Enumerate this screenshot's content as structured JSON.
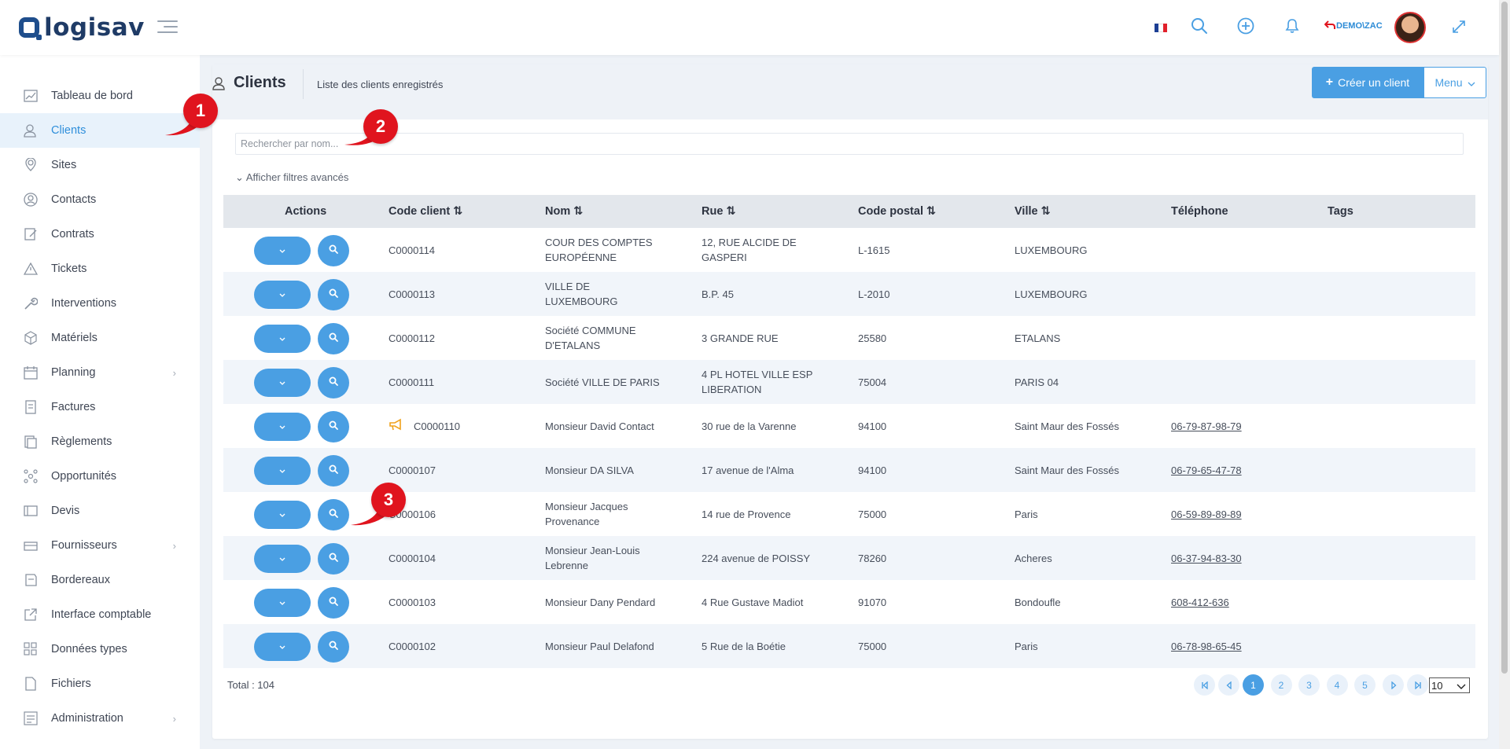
{
  "app": {
    "logo_text": "logisav",
    "user_label": "DEMO\\ZAC"
  },
  "colors": {
    "accent": "#4a9fe3",
    "brand": "#1f3b66",
    "annotation": "#e0141e"
  },
  "sidebar": {
    "items": [
      {
        "label": "Tableau de bord",
        "icon": "dashboard-icon"
      },
      {
        "label": "Clients",
        "icon": "users-icon",
        "active": true
      },
      {
        "label": "Sites",
        "icon": "location-icon"
      },
      {
        "label": "Contacts",
        "icon": "contact-icon"
      },
      {
        "label": "Contrats",
        "icon": "contract-icon"
      },
      {
        "label": "Tickets",
        "icon": "warning-icon"
      },
      {
        "label": "Interventions",
        "icon": "wrench-icon"
      },
      {
        "label": "Matériels",
        "icon": "box-icon"
      },
      {
        "label": "Planning",
        "icon": "calendar-icon",
        "has_children": true
      },
      {
        "label": "Factures",
        "icon": "invoice-icon"
      },
      {
        "label": "Règlements",
        "icon": "payment-icon"
      },
      {
        "label": "Opportunités",
        "icon": "network-icon"
      },
      {
        "label": "Devis",
        "icon": "quote-icon"
      },
      {
        "label": "Fournisseurs",
        "icon": "supplier-icon",
        "has_children": true
      },
      {
        "label": "Bordereaux",
        "icon": "slip-icon"
      },
      {
        "label": "Interface comptable",
        "icon": "external-icon"
      },
      {
        "label": "Données types",
        "icon": "grid-icon"
      },
      {
        "label": "Fichiers",
        "icon": "file-icon"
      },
      {
        "label": "Administration",
        "icon": "settings-list-icon",
        "has_children": true
      }
    ]
  },
  "page": {
    "title": "Clients",
    "subtitle": "Liste des clients enregistrés",
    "create_button": "Créer un client",
    "menu_button": "Menu",
    "search_placeholder": "Rechercher par nom...",
    "advanced_filters": "Afficher filtres avancés"
  },
  "table": {
    "headers": {
      "actions": "Actions",
      "code": "Code client",
      "nom": "Nom",
      "rue": "Rue",
      "cp": "Code postal",
      "ville": "Ville",
      "tel": "Téléphone",
      "tags": "Tags"
    },
    "rows": [
      {
        "code": "C0000114",
        "nom": "COUR DES COMPTES EUROPÉENNE",
        "rue": "12, RUE ALCIDE DE GASPERI",
        "cp": "L-1615",
        "ville": "LUXEMBOURG",
        "tel": ""
      },
      {
        "code": "C0000113",
        "nom": "VILLE DE LUXEMBOURG",
        "rue": "B.P. 45",
        "cp": "L-2010",
        "ville": "LUXEMBOURG",
        "tel": ""
      },
      {
        "code": "C0000112",
        "nom": "Société COMMUNE D'ETALANS",
        "rue": "3 GRANDE RUE",
        "cp": "25580",
        "ville": "ETALANS",
        "tel": ""
      },
      {
        "code": "C0000111",
        "nom": "Société VILLE DE PARIS",
        "rue": "4 PL HOTEL VILLE ESP LIBERATION",
        "cp": "75004",
        "ville": "PARIS 04",
        "tel": ""
      },
      {
        "code": "C0000110",
        "nom": "Monsieur David Contact",
        "rue": "30 rue de la Varenne",
        "cp": "94100",
        "ville": "Saint Maur des Fossés",
        "tel": "06-79-87-98-79",
        "flag": true
      },
      {
        "code": "C0000107",
        "nom": "Monsieur DA SILVA",
        "rue": "17 avenue de l'Alma",
        "cp": "94100",
        "ville": "Saint Maur des Fossés",
        "tel": "06-79-65-47-78"
      },
      {
        "code": "C0000106",
        "nom": "Monsieur Jacques Provenance",
        "rue": "14 rue de Provence",
        "cp": "75000",
        "ville": "Paris",
        "tel": "06-59-89-89-89"
      },
      {
        "code": "C0000104",
        "nom": "Monsieur Jean-Louis Lebrenne",
        "rue": "224 avenue de POISSY",
        "cp": "78260",
        "ville": "Acheres",
        "tel": "06-37-94-83-30"
      },
      {
        "code": "C0000103",
        "nom": "Monsieur Dany Pendard",
        "rue": "4 Rue Gustave Madiot",
        "cp": "91070",
        "ville": "Bondoufle",
        "tel": "608-412-636"
      },
      {
        "code": "C0000102",
        "nom": "Monsieur Paul Delafond",
        "rue": "5 Rue de la Boétie",
        "cp": "75000",
        "ville": "Paris",
        "tel": "06-78-98-65-45"
      }
    ]
  },
  "footer": {
    "total": "Total : 104",
    "pages": [
      "1",
      "2",
      "3",
      "4",
      "5"
    ],
    "current_page": "1",
    "page_size": "10"
  },
  "annotations": [
    "1",
    "2",
    "3"
  ]
}
